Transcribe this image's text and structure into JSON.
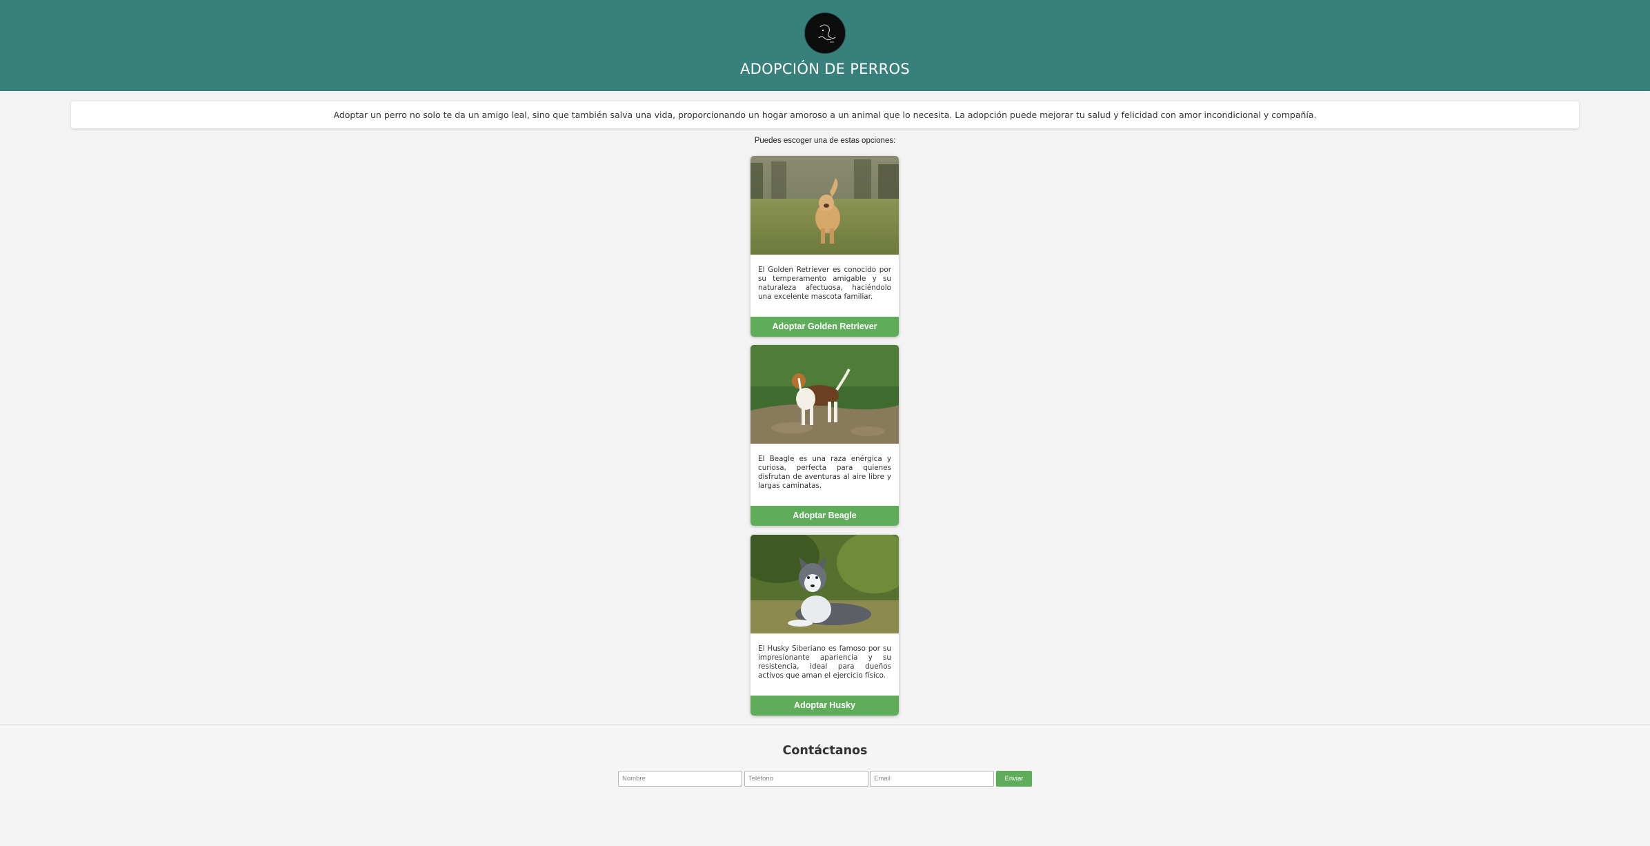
{
  "header": {
    "title": "ADOPCIÓN DE PERROS",
    "logo_icon": "dog-logo-icon"
  },
  "intro": {
    "text": "Adoptar un perro no solo te da un amigo leal, sino que también salva una vida, proporcionando un hogar amoroso a un animal que lo necesita. La adopción puede mejorar tu salud y felicidad con amor incondicional y compañía."
  },
  "options_label": "Puedes escoger una de estas opciones:",
  "cards": [
    {
      "photo": "golden-retriever-photo",
      "description": "El Golden Retriever es conocido por su temperamento amigable y su naturaleza afectuosa, haciéndolo una excelente mascota familiar.",
      "button_label": "Adoptar Golden Retriever"
    },
    {
      "photo": "beagle-photo",
      "description": "El Beagle es una raza enérgica y curiosa, perfecta para quienes disfrutan de aventuras al aire libre y largas caminatas.",
      "button_label": "Adoptar Beagle"
    },
    {
      "photo": "husky-photo",
      "description": "El Husky Siberiano es famoso por su impresionante apariencia y su resistencia, ideal para dueños activos que aman el ejercicio físico.",
      "button_label": "Adoptar Husky"
    }
  ],
  "contact": {
    "title": "Contáctanos",
    "name_placeholder": "Nombre",
    "phone_placeholder": "Teléfono",
    "email_placeholder": "Email",
    "send_label": "Enviar"
  },
  "colors": {
    "header_bg": "#37807c",
    "button_green": "#5fac5a",
    "page_bg": "#f3f3f3"
  }
}
